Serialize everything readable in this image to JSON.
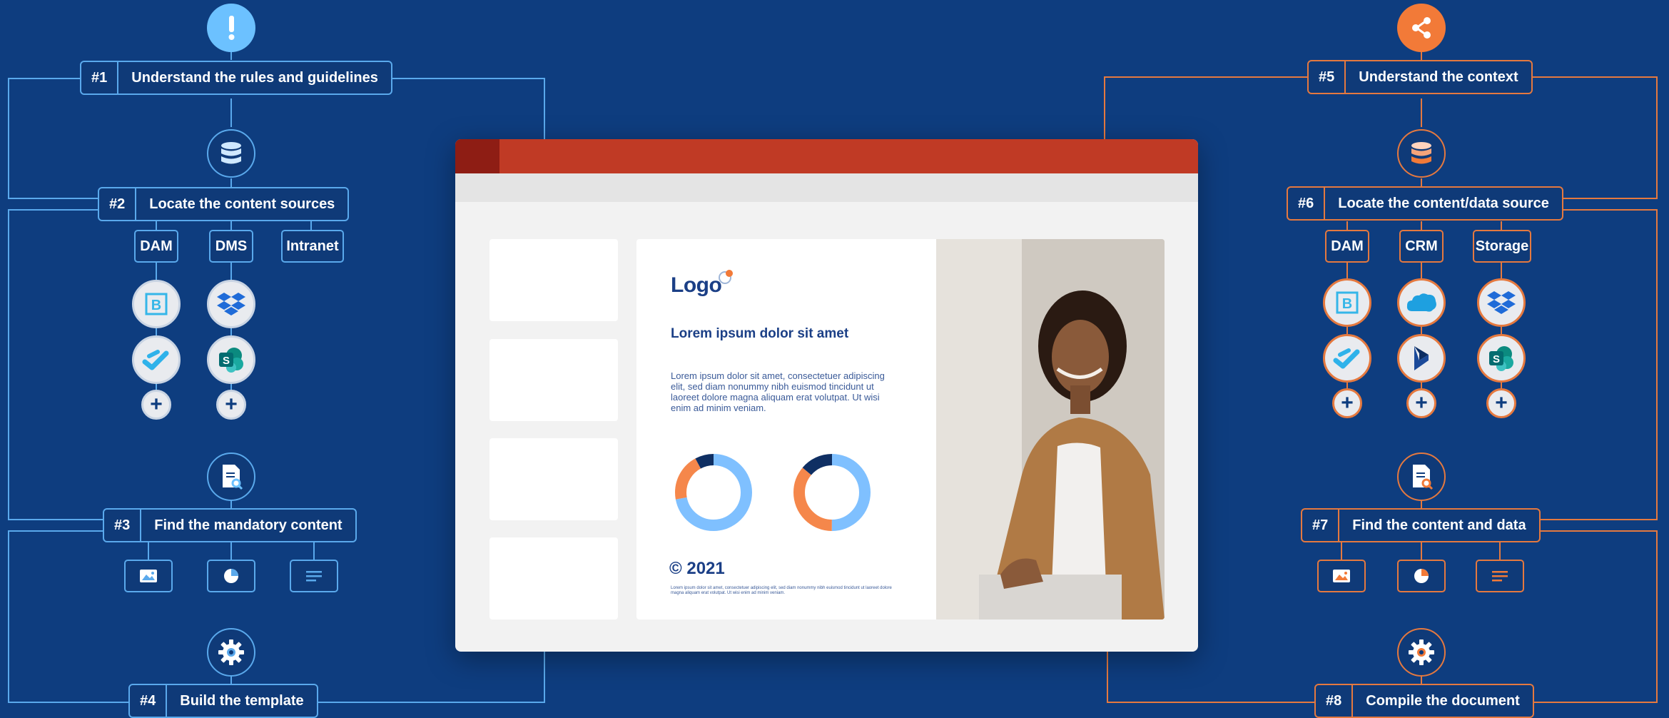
{
  "colors": {
    "background": "#0e3d7f",
    "blue_accent": "#5aa9ec",
    "orange_accent": "#e5793f",
    "window_titlebar": "#c03a25"
  },
  "left_steps": [
    {
      "num": "#1",
      "title": "Understand the rules and guidelines",
      "icon": "alert-icon"
    },
    {
      "num": "#2",
      "title": "Locate the content sources",
      "icon": "database-icon"
    },
    {
      "num": "#3",
      "title": "Find the mandatory content",
      "icon": "document-search-icon"
    },
    {
      "num": "#4",
      "title": "Build the template",
      "icon": "gear-icon"
    }
  ],
  "right_steps": [
    {
      "num": "#5",
      "title": "Understand the context",
      "icon": "share-icon"
    },
    {
      "num": "#6",
      "title": "Locate the content/data source",
      "icon": "database-icon"
    },
    {
      "num": "#7",
      "title": "Find the content and data",
      "icon": "document-search-icon"
    },
    {
      "num": "#8",
      "title": "Compile the document",
      "icon": "gear-icon"
    }
  ],
  "left_sources": [
    "DAM",
    "DMS",
    "Intranet"
  ],
  "right_sources": [
    "DAM",
    "CRM",
    "Storage"
  ],
  "left_apps": [
    "bynder-icon",
    "dropbox-icon",
    "sync-link-icon",
    "sharepoint-icon"
  ],
  "right_apps": [
    "bynder-icon",
    "salesforce-icon",
    "dropbox-icon",
    "sync-link-icon",
    "dynamics-icon",
    "sharepoint-icon"
  ],
  "plus_label": "+",
  "content_types": [
    "image-icon",
    "pie-chart-icon",
    "text-lines-icon"
  ],
  "mockup": {
    "logo": "Logo",
    "title": "Lorem ipsum dolor sit amet",
    "body": "Lorem ipsum dolor sit amet, consectetuer adipiscing elit, sed diam nonummy nibh euismod tincidunt ut laoreet dolore magna aliquam erat volutpat. Ut wisi enim ad minim veniam.",
    "copyright": "© 2021",
    "fine_print": "Lorem ipsum dolor sit amet, consectetuer adipiscing elit, sed diam nonummy nibh euismod tincidunt ut laoreet dolore magna aliquam erat volutpat. Ut wisi enim ad minim veniam.",
    "donuts": [
      {
        "blue": 0.72,
        "orange": 0.2,
        "navy": 0.08
      },
      {
        "blue": 0.5,
        "orange": 0.36,
        "navy": 0.14
      }
    ]
  }
}
